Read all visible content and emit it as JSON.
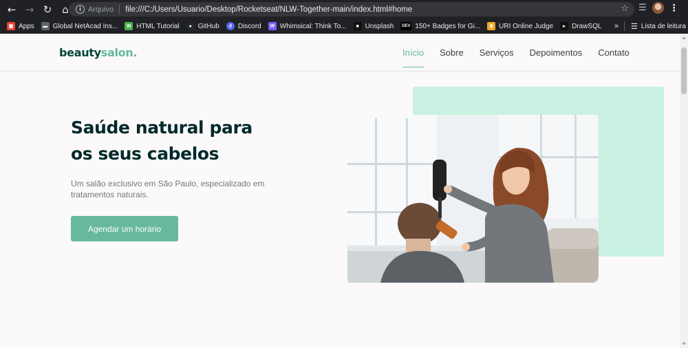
{
  "browser": {
    "scheme_label": "Arquivo",
    "url": "file:///C:/Users/Usuario/Desktop/Rocketseat/NLW-Together-main/index.html#home",
    "bookmarks": [
      {
        "label": "Apps",
        "icon": "apps-grid-icon",
        "color": "#ea4335"
      },
      {
        "label": "Global NetAcad Ins...",
        "icon": "netacad-icon",
        "color": "#5f6368"
      },
      {
        "label": "HTML Tutorial",
        "icon": "w3schools-icon",
        "color": "#4caf50"
      },
      {
        "label": "GitHub",
        "icon": "github-icon",
        "color": "#24292e"
      },
      {
        "label": "Discord",
        "icon": "discord-icon",
        "color": "#5865f2"
      },
      {
        "label": "Whimsical: Think To...",
        "icon": "whimsical-icon",
        "color": "#7b61ff"
      },
      {
        "label": "Unsplash",
        "icon": "unsplash-icon",
        "color": "#111111"
      },
      {
        "label": "150+ Badges for Gi...",
        "icon": "dev-icon",
        "color": "#000000"
      },
      {
        "label": "URI Online Judge",
        "icon": "uri-icon",
        "color": "#f4a623"
      },
      {
        "label": "DrawSQL",
        "icon": "drawsql-icon",
        "color": "#111111"
      }
    ],
    "more_label": "»",
    "reading_list_label": "Lista de leitura"
  },
  "site": {
    "logo_main": "beauty",
    "logo_accent": "salon.",
    "nav": [
      "Início",
      "Sobre",
      "Serviços",
      "Depoimentos",
      "Contato"
    ],
    "active_nav": "Início",
    "hero": {
      "title": "Saúde natural para os seus cabelos",
      "text": "Um salão exclusivo em São Paulo, especializado em tratamentos naturais.",
      "cta": "Agendar um horário"
    }
  },
  "colors": {
    "brand_dark": "#00453a",
    "accent": "#66b89e",
    "mint": "#c8f1e1",
    "page_bg": "#fbf9f9"
  }
}
